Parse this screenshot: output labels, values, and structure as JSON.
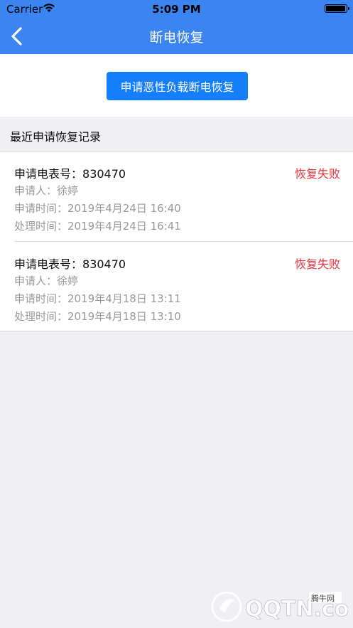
{
  "status_bar": {
    "carrier": "Carrier",
    "time": "5:09 PM",
    "battery_level": 0.95
  },
  "nav": {
    "title": "断电恢复",
    "back_icon": "chevron-left-icon"
  },
  "apply_button": {
    "label": "申请恶性负载断电恢复"
  },
  "section": {
    "title": "最近申请恢复记录"
  },
  "records": [
    {
      "meter_label": "申请电表号：",
      "meter_value": "830470",
      "status": "恢复失败",
      "applicant_label": "申请人：",
      "applicant_value": "徐婷",
      "apply_time_label": "申请时间：",
      "apply_time_value": "2019年4月24日 16:40",
      "process_time_label": "处理时间：",
      "process_time_value": "2019年4月24日 16:41"
    },
    {
      "meter_label": "申请电表号：",
      "meter_value": "830470",
      "status": "恢复失败",
      "applicant_label": "申请人：",
      "applicant_value": "徐婷",
      "apply_time_label": "申请时间：",
      "apply_time_value": "2019年4月18日 13:11",
      "process_time_label": "处理时间：",
      "process_time_value": "2019年4月18日 13:10"
    }
  ],
  "watermark": {
    "text": "QQTN.com",
    "sub": "腾牛网"
  },
  "colors": {
    "nav": "#3c84f0",
    "button": "#157efb",
    "status_fail": "#e8323c"
  }
}
